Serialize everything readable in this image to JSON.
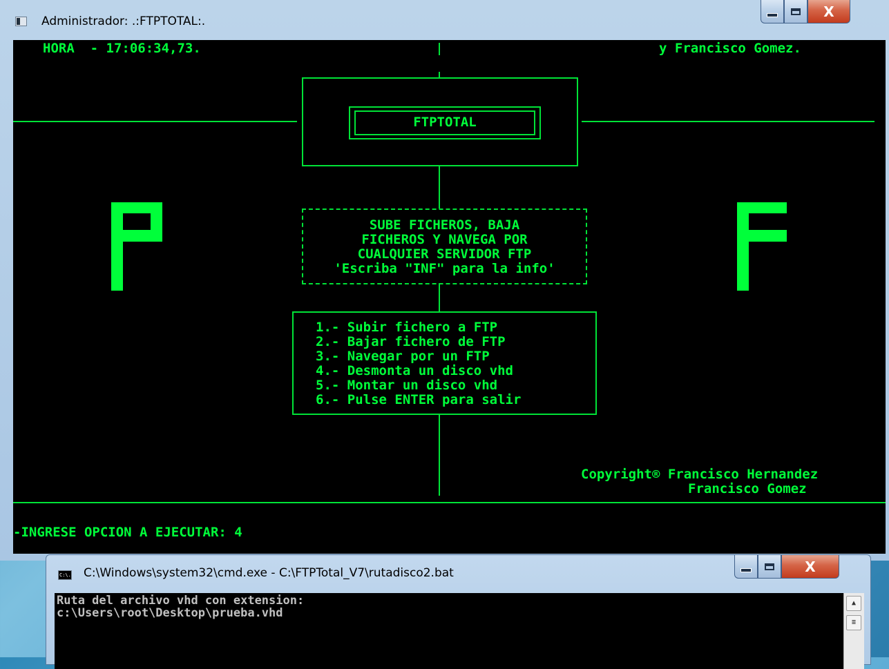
{
  "main_window": {
    "title": "Administrador:  .:FTPTOTAL:.",
    "controls": {
      "minimize": "minimize",
      "maximize": "maximize",
      "close": "X"
    }
  },
  "console": {
    "clock": "HORA  - 17:06:34,73.",
    "author_top": "y Francisco Gomez.",
    "banner": "FTPTOTAL",
    "left_letter": "P",
    "right_letter": "F",
    "description": [
      "SUBE FICHEROS, BAJA",
      "FICHEROS Y NAVEGA POR",
      "CUALQUIER SERVIDOR FTP",
      "'Escriba \"INF\" para la info'"
    ],
    "menu": [
      "1.- Subir fichero a FTP",
      "2.- Bajar fichero de FTP",
      "3.- Navegar por un FTP",
      "4.- Desmonta un disco vhd",
      "5.- Montar un disco vhd",
      "6.- Pulse ENTER para salir"
    ],
    "copyright_1": "Copyright® Francisco Hernandez",
    "copyright_2": "Francisco Gomez",
    "prompt": "-INGRESE OPCION A EJECUTAR: 4"
  },
  "second_window": {
    "title": "C:\\Windows\\system32\\cmd.exe - C:\\FTPTotal_V7\\rutadisco2.bat",
    "icon_label": "C:\\.",
    "lines": [
      "Ruta del archivo vhd con extension:",
      "c:\\Users\\root\\Desktop\\prueba.vhd"
    ]
  },
  "colors": {
    "console_text": "#00ff3a",
    "console_bg": "#000000"
  }
}
